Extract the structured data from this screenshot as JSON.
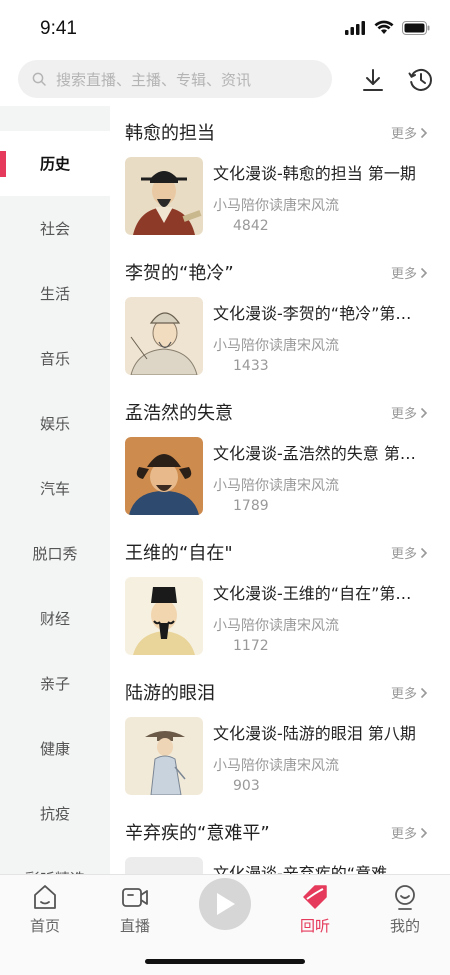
{
  "status_bar": {
    "time": "9:41"
  },
  "search": {
    "placeholder": "搜索直播、主播、专辑、资讯"
  },
  "sidebar": {
    "items": [
      {
        "label": "历史",
        "active": true
      },
      {
        "label": "社会"
      },
      {
        "label": "生活"
      },
      {
        "label": "音乐"
      },
      {
        "label": "娱乐"
      },
      {
        "label": "汽车"
      },
      {
        "label": "脱口秀"
      },
      {
        "label": "财经"
      },
      {
        "label": "亲子"
      },
      {
        "label": "健康"
      },
      {
        "label": "抗疫"
      },
      {
        "label": "彩听精选"
      }
    ]
  },
  "sections": [
    {
      "title": "韩愈的担当",
      "more": "更多",
      "episode": "文化漫谈-韩愈的担当 第一期",
      "author": "小马陪你读唐宋风流",
      "plays": "4842"
    },
    {
      "title": "李贺的“艳冷”",
      "more": "更多",
      "episode": "文化漫谈-李贺的“艳冷”第…",
      "author": "小马陪你读唐宋风流",
      "plays": "1433"
    },
    {
      "title": "孟浩然的失意",
      "more": "更多",
      "episode": "文化漫谈-孟浩然的失意 第…",
      "author": "小马陪你读唐宋风流",
      "plays": "1789"
    },
    {
      "title": "王维的“自在\"",
      "more": "更多",
      "episode": "文化漫谈-王维的“自在”第…",
      "author": "小马陪你读唐宋风流",
      "plays": "1172"
    },
    {
      "title": "陆游的眼泪",
      "more": "更多",
      "episode": "文化漫谈-陆游的眼泪 第八期",
      "author": "小马陪你读唐宋风流",
      "plays": "903"
    },
    {
      "title": "辛弃疾的“意难平”",
      "more": "更多",
      "episode": "文化漫谈-辛弃疾的“意难",
      "author": "",
      "plays": ""
    }
  ],
  "tabbar": {
    "home": "首页",
    "live": "直播",
    "replay": "回听",
    "mine": "我的"
  },
  "colors": {
    "accent": "#e53a5b",
    "sidebar_bg": "#f3f4f4",
    "muted": "#999999"
  },
  "icons": {
    "search": "search-icon",
    "download": "download-icon",
    "history": "history-icon",
    "play": "play-icon"
  }
}
